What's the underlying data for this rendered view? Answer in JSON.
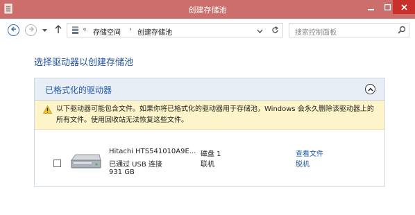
{
  "window": {
    "title": "创建存储池",
    "title_bar_color": "#cc6e6b"
  },
  "nav": {
    "address": {
      "breadcrumb": [
        "存储空间",
        "创建存储池"
      ]
    },
    "search": {
      "placeholder": "搜索控制面板"
    }
  },
  "page": {
    "heading": "选择驱动器以创建存储池"
  },
  "panel": {
    "title": "已格式化的驱动器",
    "warning": "以下驱动器可能包含文件。如果你将已格式化的驱动器用于存储池，Windows 会永久删除该驱动器上的所有文件。使用回收站无法恢复这些文件。",
    "drives": [
      {
        "name": "Hitachi HTS541010A9E...",
        "connection": "已通过 USB 连接",
        "size": "931 GB",
        "disk": "磁盘 1",
        "status": "联机",
        "link_view": "查看文件",
        "link_offline": "脱机",
        "checked": false
      }
    ]
  },
  "icons": {
    "titlebar": "control-panel-icon",
    "back": "back-arrow-icon",
    "forward": "forward-arrow-icon",
    "up": "up-arrow-icon",
    "address": "storage-spaces-icon",
    "refresh": "refresh-icon",
    "search": "search-icon",
    "collapse": "chevron-up-icon",
    "warning": "warning-icon",
    "drive": "hard-drive-icon"
  },
  "colors": {
    "accent": "#1e5aa8",
    "warning_bg": "#fdf5c9"
  }
}
